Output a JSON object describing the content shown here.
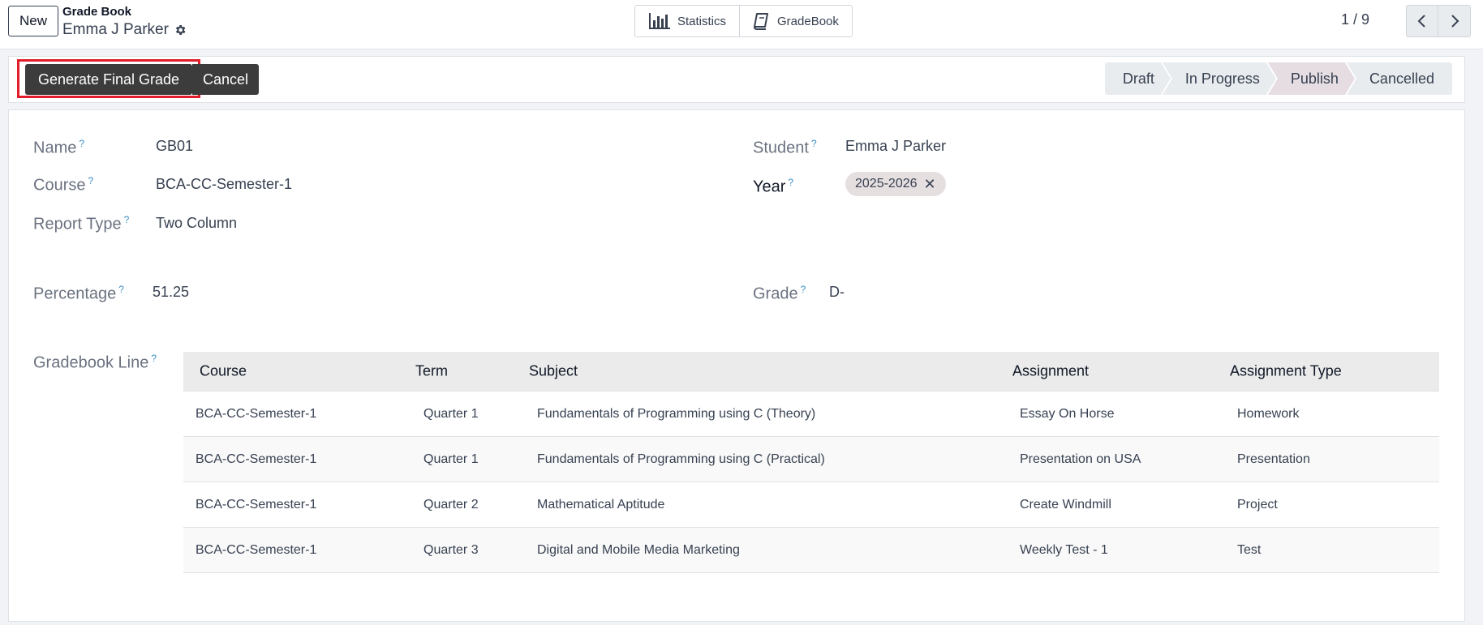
{
  "control_panel": {
    "new_label": "New",
    "breadcrumb_parent": "Grade Book",
    "breadcrumb_current": "Emma J Parker",
    "smart_buttons": [
      {
        "icon": "bar-chart-icon",
        "label": "Statistics"
      },
      {
        "icon": "book-icon",
        "label": "GradeBook"
      }
    ],
    "pager": "1 / 9"
  },
  "header": {
    "generate_label": "Generate Final Grade",
    "cancel_label": "Cancel",
    "stages": [
      "Draft",
      "In Progress",
      "Publish",
      "Cancelled"
    ],
    "active_stage": "Publish"
  },
  "form": {
    "name_label": "Name",
    "name_value": "GB01",
    "course_label": "Course",
    "course_value": "BCA-CC-Semester-1",
    "report_type_label": "Report Type",
    "report_type_value": "Two Column",
    "student_label": "Student",
    "student_value": "Emma J Parker",
    "year_label": "Year",
    "year_tag": "2025-2026",
    "percentage_label": "Percentage",
    "percentage_value": "51.25",
    "grade_label": "Grade",
    "grade_value": "D-",
    "gradebook_line_label": "Gradebook Line",
    "help_mark": "?"
  },
  "table": {
    "columns": [
      "Course",
      "Term",
      "Subject",
      "Assignment",
      "Assignment Type"
    ],
    "rows": [
      [
        "BCA-CC-Semester-1",
        "Quarter 1",
        "Fundamentals of Programming using C (Theory)",
        "Essay On Horse",
        "Homework"
      ],
      [
        "BCA-CC-Semester-1",
        "Quarter 1",
        "Fundamentals of Programming using C (Practical)",
        "Presentation on USA",
        "Presentation"
      ],
      [
        "BCA-CC-Semester-1",
        "Quarter 2",
        "Mathematical Aptitude",
        "Create Windmill",
        "Project"
      ],
      [
        "BCA-CC-Semester-1",
        "Quarter 3",
        "Digital and Mobile Media Marketing",
        "Weekly Test - 1",
        "Test"
      ]
    ]
  },
  "colors": {
    "accent_dark": "#3c3c3c",
    "highlight_box": "#e11d2a",
    "help_mark": "#3b8fc9"
  }
}
